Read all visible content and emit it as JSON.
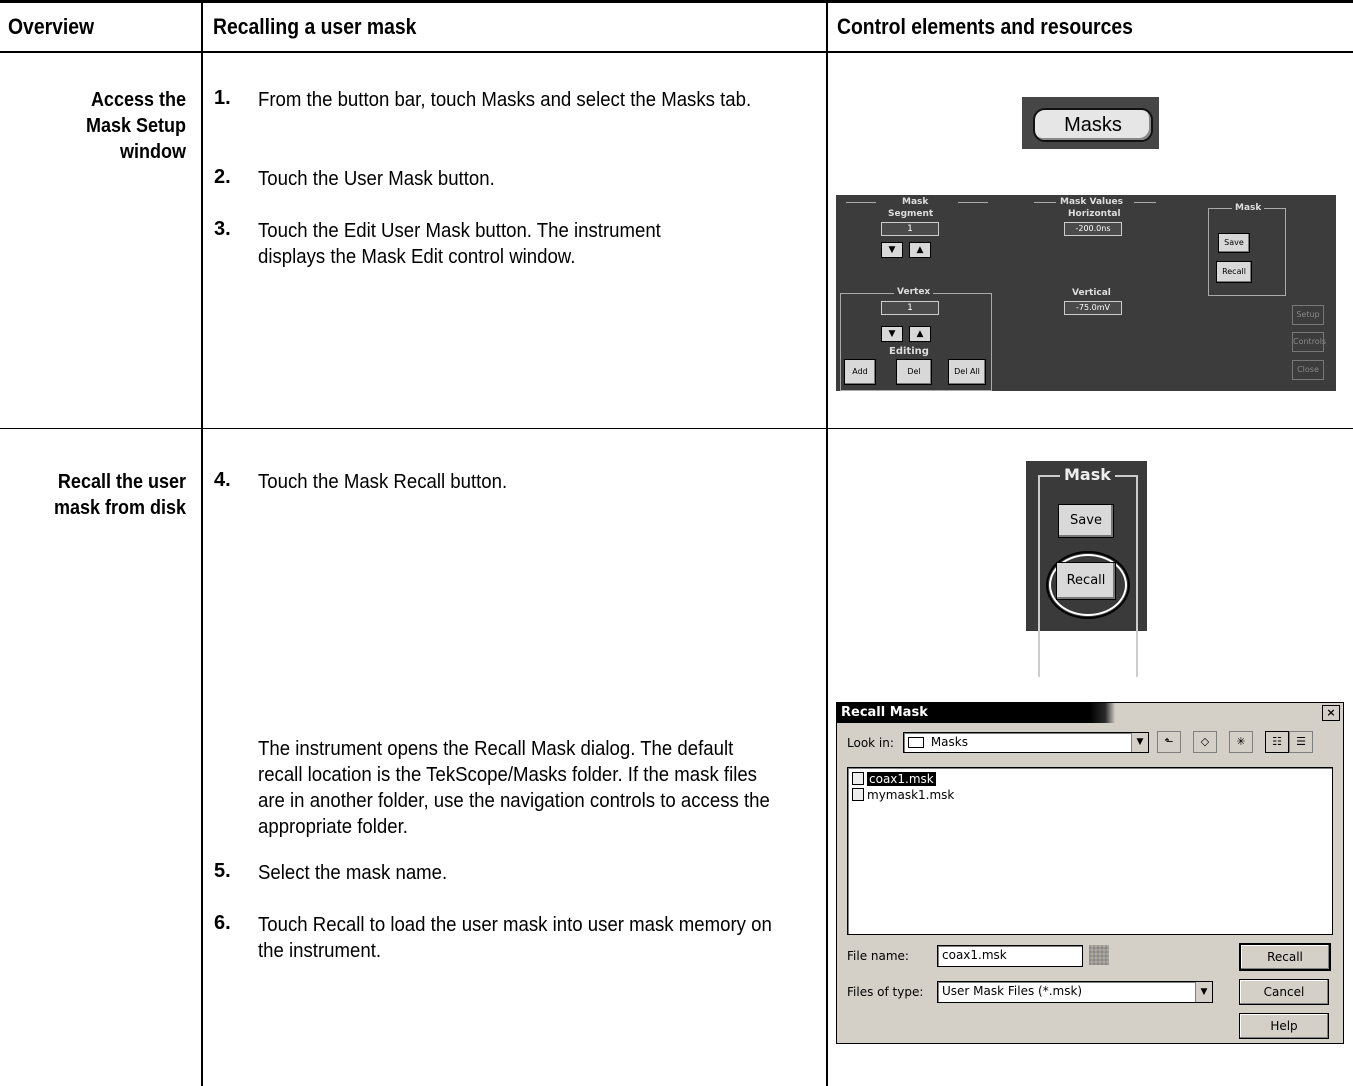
{
  "header": {
    "col1": "Overview",
    "col2": "Recalling a user mask",
    "col3": "Control elements and resources"
  },
  "rows": [
    {
      "label": "Access the Mask Setup window",
      "label_lines": [
        "Access the",
        "Mask Setup",
        "window"
      ],
      "steps": [
        {
          "num": "1.",
          "text": "From the button bar, touch Masks and select the Masks tab."
        },
        {
          "num": "2.",
          "text": "Touch the User Mask button."
        },
        {
          "num": "3.",
          "text": "Touch the Edit User Mask button. The instrument displays the Mask Edit control window."
        }
      ]
    },
    {
      "label": "Recall the user mask from disk",
      "label_lines": [
        "Recall the user",
        "mask from disk"
      ],
      "steps": [
        {
          "num": "4.",
          "text": "Touch the Mask Recall button."
        },
        {
          "num": "",
          "text": "The instrument opens the Recall Mask dialog. The default recall location is the TekScope/Masks folder. If the mask files are in another folder, use the navigation controls to access the appropriate folder."
        },
        {
          "num": "5.",
          "text": "Select the mask name."
        },
        {
          "num": "6.",
          "text": "Touch Recall to load the user mask into user mask memory on the instrument."
        }
      ]
    }
  ],
  "masks_button": {
    "label": "Masks"
  },
  "mask_edit_window": {
    "mask_title": "Mask",
    "segment_label": "Segment",
    "segment_value": "1",
    "vertex_label": "Vertex",
    "vertex_value": "1",
    "editing_label": "Editing",
    "add": "Add",
    "del": "Del",
    "del_all": "Del All",
    "mask_values_title": "Mask Values",
    "horizontal_label": "Horizontal",
    "horizontal_value": "-200.0ns",
    "vertical_label": "Vertical",
    "vertical_value": "-75.0mV",
    "mask_group_title": "Mask",
    "save": "Save",
    "recall": "Recall",
    "setup": "Setup",
    "controls": "Controls",
    "close": "Close",
    "up_arrow": "▲",
    "down_arrow": "▼"
  },
  "mask_zoom": {
    "title": "Mask",
    "save": "Save",
    "recall": "Recall"
  },
  "recall_dialog": {
    "title": "Recall Mask",
    "close_glyph": "×",
    "look_in_label": "Look in:",
    "look_in_value": "Masks",
    "files": [
      "coax1.msk",
      "mymask1.msk"
    ],
    "selected_file": "coax1.msk",
    "file_name_label": "File name:",
    "file_name_value": "coax1.msk",
    "files_of_type_label": "Files of type:",
    "files_of_type_value": "User Mask Files (*.msk)",
    "recall_button": "Recall",
    "cancel_button": "Cancel",
    "help_button": "Help"
  }
}
